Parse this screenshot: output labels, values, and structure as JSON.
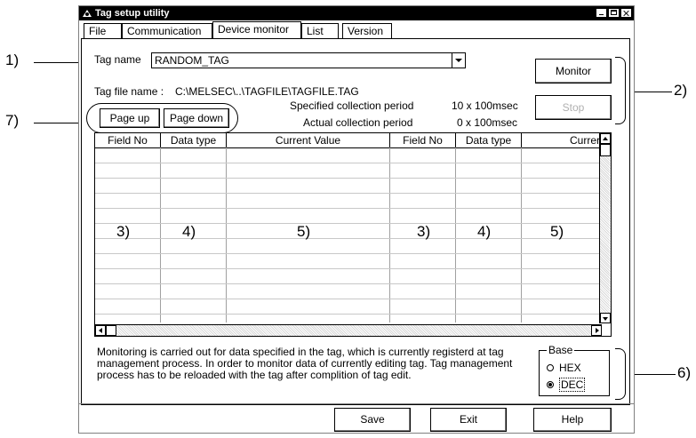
{
  "window": {
    "title": "Tag setup utility"
  },
  "tabs": [
    "File",
    "Communication",
    "Device monitor",
    "List",
    "Version"
  ],
  "tag_name": {
    "label": "Tag name",
    "value": "RANDOM_TAG"
  },
  "tag_file": {
    "label": "Tag file name :",
    "value": "C:\\MELSEC\\..\\TAGFILE\\TAGFILE.TAG"
  },
  "periods": {
    "specified_label": "Specified collection period",
    "specified_value": "10 x 100msec",
    "actual_label": "Actual collection period",
    "actual_value": "0 x 100msec"
  },
  "buttons": {
    "monitor": "Monitor",
    "stop": "Stop",
    "page_up": "Page up",
    "page_down": "Page down",
    "save": "Save",
    "exit": "Exit",
    "help": "Help"
  },
  "grid": {
    "columns": [
      "Field No",
      "Data type",
      "Current Value",
      "Field No",
      "Data type",
      "Currer"
    ],
    "markers": [
      "3)",
      "4)",
      "5)",
      "3)",
      "4)",
      "5)"
    ]
  },
  "note": "Monitoring is carried out for data specified in the tag, which is currently registerd at tag management process. In order to monitor data of currently editing tag. Tag management process has to be reloaded with the tag after complition of tag edit.",
  "base": {
    "legend": "Base",
    "options": [
      "HEX",
      "DEC"
    ],
    "selected": "DEC"
  },
  "callouts": {
    "c1": "1)",
    "c2": "2)",
    "c6": "6)",
    "c7": "7)"
  }
}
